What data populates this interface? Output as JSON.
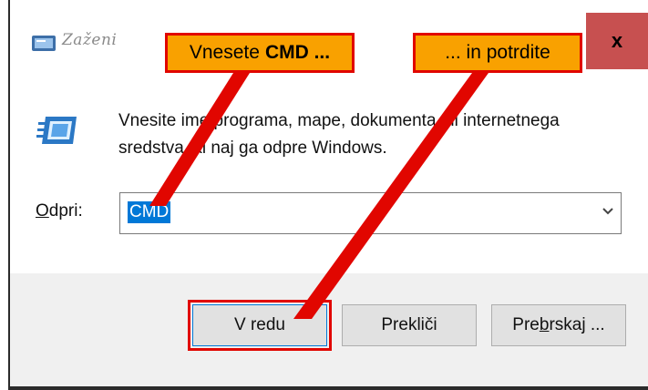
{
  "window": {
    "title": "Zaženi",
    "close_label": "x"
  },
  "dialog": {
    "description": "Vnesite ime programa, mape, dokumenta ali internetnega sredstva, ki naj ga odpre Windows.",
    "open_label_accel": "O",
    "open_label_rest": "dpri:",
    "open_value": "CMD"
  },
  "buttons": {
    "ok": "V redu",
    "cancel": "Prekliči",
    "browse_pre": "Pre",
    "browse_accel": "b",
    "browse_post": "rskaj ..."
  },
  "callouts": {
    "type_prefix": "Vnesete",
    "type_bold": "CMD ...",
    "confirm": "... in potrdite"
  },
  "colors": {
    "callout_fill": "#f9a100",
    "callout_border": "#e10600",
    "close_button": "#c75050",
    "selection": "#0078d7"
  },
  "icons": [
    "run-app-icon",
    "run-dialog-icon",
    "dropdown-chevron-icon",
    "close-icon"
  ]
}
